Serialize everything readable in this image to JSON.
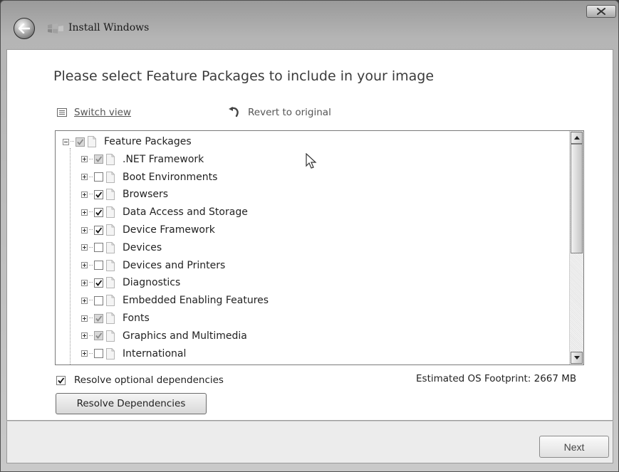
{
  "window": {
    "title": "Install Windows",
    "icons": {
      "back": "back-arrow-icon",
      "app": "windows-setup-icon",
      "close": "close-icon"
    }
  },
  "heading": "Please select Feature Packages to include in your image",
  "toolbar": {
    "switch_view_label": "Switch view",
    "revert_label": "Revert to original"
  },
  "tree": {
    "root": {
      "label": "Feature Packages",
      "state": "partial"
    },
    "items": [
      {
        "label": ".NET Framework",
        "state": "partial"
      },
      {
        "label": "Boot Environments",
        "state": "unchecked"
      },
      {
        "label": "Browsers",
        "state": "checked"
      },
      {
        "label": "Data Access and Storage",
        "state": "checked"
      },
      {
        "label": "Device Framework",
        "state": "checked"
      },
      {
        "label": "Devices",
        "state": "unchecked"
      },
      {
        "label": "Devices and Printers",
        "state": "unchecked"
      },
      {
        "label": "Diagnostics",
        "state": "checked"
      },
      {
        "label": "Embedded Enabling Features",
        "state": "unchecked"
      },
      {
        "label": "Fonts",
        "state": "partial"
      },
      {
        "label": "Graphics and Multimedia",
        "state": "partial"
      },
      {
        "label": "International",
        "state": "unchecked"
      }
    ]
  },
  "resolve_optional": {
    "label": "Resolve optional dependencies",
    "checked": true
  },
  "footprint": "Estimated OS Footprint: 2667 MB",
  "resolve_button_label": "Resolve Dependencies",
  "next_button_label": "Next",
  "colors": {
    "window_frame": "#9a9a9a",
    "content_bg": "#ffffff",
    "footer_bg": "#ececec"
  }
}
